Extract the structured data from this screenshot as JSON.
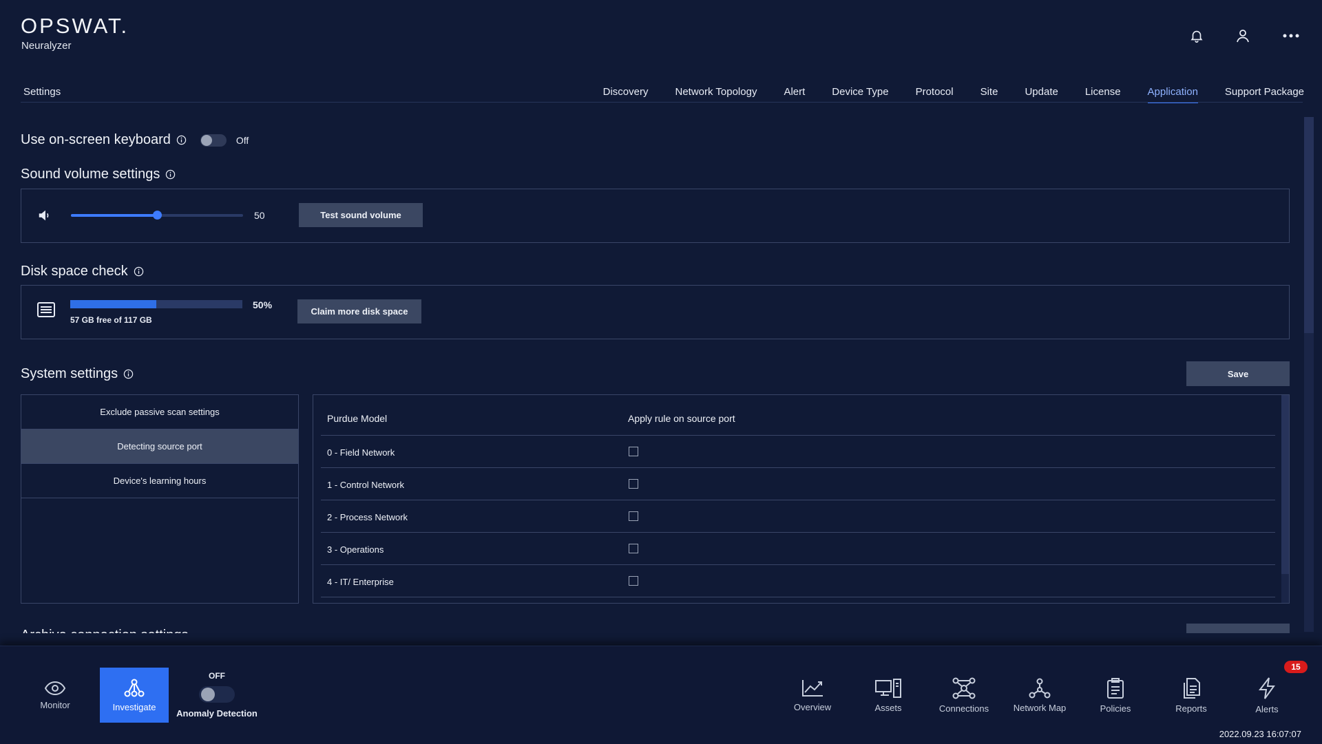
{
  "app": {
    "brand": "OPSWAT.",
    "product": "Neuralyzer"
  },
  "header_icons": [
    "bell-icon",
    "user-icon",
    "more-icon"
  ],
  "settings_title": "Settings",
  "tabs": [
    {
      "label": "Discovery"
    },
    {
      "label": "Network Topology"
    },
    {
      "label": "Alert"
    },
    {
      "label": "Device Type"
    },
    {
      "label": "Protocol"
    },
    {
      "label": "Site"
    },
    {
      "label": "Update"
    },
    {
      "label": "License"
    },
    {
      "label": "Application",
      "active": true
    },
    {
      "label": "Support Package"
    }
  ],
  "keyboard": {
    "title": "Use on-screen keyboard",
    "state": "Off",
    "enabled": false
  },
  "sound": {
    "title": "Sound volume settings",
    "volume": 50,
    "volume_label": "50",
    "max": 100,
    "button": "Test sound volume"
  },
  "disk": {
    "title": "Disk space check",
    "percent": 50,
    "percent_label": "50%",
    "free_text": "57 GB free of 117 GB",
    "button": "Claim more disk space"
  },
  "system": {
    "title": "System settings",
    "save_label": "Save",
    "menu": [
      {
        "label": "Exclude passive scan settings"
      },
      {
        "label": "Detecting source port",
        "active": true
      },
      {
        "label": "Device's learning hours"
      }
    ],
    "table": {
      "headers": [
        "Purdue Model",
        "Apply rule on source port"
      ],
      "rows": [
        {
          "label": "0 - Field Network",
          "checked": false
        },
        {
          "label": "1 - Control Network",
          "checked": false
        },
        {
          "label": "2 - Process Network",
          "checked": false
        },
        {
          "label": "3 - Operations",
          "checked": false
        },
        {
          "label": "4 - IT/ Enterprise",
          "checked": false
        }
      ]
    }
  },
  "next_section": {
    "title": "Archive connection settings"
  },
  "bottom_nav": {
    "left": [
      {
        "label": "Monitor",
        "icon": "eye-icon"
      },
      {
        "label": "Investigate",
        "icon": "hierarchy-icon",
        "active": true
      }
    ],
    "anomaly": {
      "label": "Anomaly Detection",
      "state": "OFF",
      "enabled": false
    },
    "right": [
      {
        "label": "Overview",
        "icon": "chart-icon"
      },
      {
        "label": "Assets",
        "icon": "devices-icon"
      },
      {
        "label": "Connections",
        "icon": "connections-icon"
      },
      {
        "label": "Network Map",
        "icon": "network-map-icon"
      },
      {
        "label": "Policies",
        "icon": "clipboard-icon"
      },
      {
        "label": "Reports",
        "icon": "reports-icon"
      },
      {
        "label": "Alerts",
        "icon": "lightning-icon",
        "badge": "15"
      }
    ]
  },
  "datetime": "2022.09.23 16:07:07",
  "colors": {
    "background": "#101a36",
    "accent": "#3d7bff",
    "button": "#3b4762",
    "badge": "#d81b1b"
  }
}
